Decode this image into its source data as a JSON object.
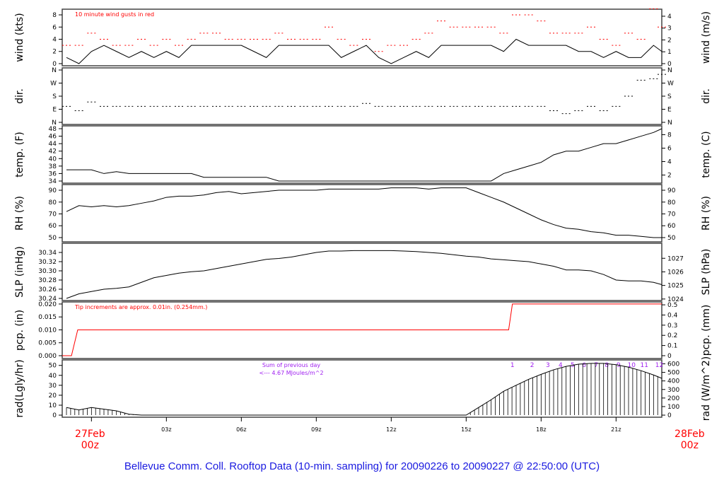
{
  "title": "Bellevue Comm. Coll. Rooftop Data (10-min. sampling) for 20090226  to  20090227 @ 22:50:00  (UTC)",
  "chart_data": {
    "type": "line",
    "title": "Bellevue Comm. Coll. Rooftop Data (10-min. sampling) for 20090226  to  20090227 @ 22:50:00  (UTC)",
    "x_range_hours": [
      -1.17,
      22.83
    ],
    "x_ticks": [
      {
        "t": 0,
        "label": "27Feb",
        "label2": "00z",
        "major": true
      },
      {
        "t": 3,
        "label": "03z"
      },
      {
        "t": 6,
        "label": "06z"
      },
      {
        "t": 9,
        "label": "09z"
      },
      {
        "t": 12,
        "label": "12z"
      },
      {
        "t": 15,
        "label": "15z"
      },
      {
        "t": 18,
        "label": "18z"
      },
      {
        "t": 21,
        "label": "21z"
      },
      {
        "t": 24,
        "label": "28Feb",
        "label2": "00z",
        "major": true
      }
    ],
    "colors": {
      "line": "#000000",
      "gust": "#ff0000",
      "pcp": "#ff0000",
      "annot": "#a020f0",
      "title": "#1a1ae0",
      "date": "#ff0000"
    },
    "t": [
      -1,
      -0.5,
      0,
      0.5,
      1,
      1.5,
      2,
      2.5,
      3,
      3.5,
      4,
      4.5,
      5,
      5.5,
      6,
      6.5,
      7,
      7.5,
      8,
      8.5,
      9,
      9.5,
      10,
      10.5,
      11,
      11.5,
      12,
      12.5,
      13,
      13.5,
      14,
      14.5,
      15,
      15.5,
      16,
      16.5,
      17,
      17.5,
      18,
      18.5,
      19,
      19.5,
      20,
      20.5,
      21,
      21.5,
      22,
      22.5,
      23
    ],
    "panels": [
      {
        "id": "wind",
        "ylabel": "wind (kts)",
        "ylabel_right": "wind (m/s)",
        "ylim": [
          -0.35,
          8.93
        ],
        "ticks": [
          {
            "v": 0,
            "l": "0"
          },
          {
            "v": 2,
            "l": "2"
          },
          {
            "v": 4,
            "l": "4"
          },
          {
            "v": 6,
            "l": "6"
          },
          {
            "v": 8,
            "l": "8"
          }
        ],
        "right_scale": 1.944,
        "right_offset": 0,
        "right_ticks": [
          {
            "v": 0,
            "l": "0"
          },
          {
            "v": 1,
            "l": "1"
          },
          {
            "v": 2,
            "l": "2"
          },
          {
            "v": 3,
            "l": "3"
          },
          {
            "v": 4,
            "l": "4"
          }
        ],
        "annotation": "10  minute wind gusts in red",
        "series": [
          {
            "name": "wind speed",
            "style": "line",
            "values": [
              1,
              0,
              2,
              3,
              2,
              1,
              2,
              1,
              2,
              1,
              3,
              3,
              3,
              3,
              3,
              2,
              1,
              3,
              3,
              3,
              3,
              3,
              1,
              2,
              3,
              1,
              0,
              1,
              2,
              1,
              3,
              3,
              3,
              3,
              3,
              2,
              4,
              3,
              3,
              3,
              3,
              2,
              2,
              1,
              2,
              1,
              1,
              3,
              2
            ]
          },
          {
            "name": "gust",
            "style": "dash-red",
            "values": [
              3,
              3,
              5,
              4,
              3,
              3,
              4,
              3,
              4,
              3,
              4,
              5,
              5,
              4,
              4,
              4,
              4,
              5,
              4,
              4,
              4,
              6,
              4,
              3,
              4,
              2,
              3,
              3,
              4,
              5,
              7,
              6,
              6,
              6,
              6,
              5,
              8,
              8,
              7,
              5,
              5,
              5,
              6,
              4,
              3,
              5,
              4,
              9,
              6
            ]
          }
        ]
      },
      {
        "id": "dir",
        "ylabel": "dir.",
        "ylabel_right": "dir.",
        "ylim": [
          -14.6,
          374.6
        ],
        "ticks": [
          {
            "v": 0,
            "l": "N"
          },
          {
            "v": 90,
            "l": "E"
          },
          {
            "v": 180,
            "l": "S"
          },
          {
            "v": 270,
            "l": "W"
          },
          {
            "v": 360,
            "l": "N"
          }
        ],
        "right_scale": 1,
        "right_offset": 0,
        "right_ticks": [
          {
            "v": 0,
            "l": "N"
          },
          {
            "v": 90,
            "l": "E"
          },
          {
            "v": 180,
            "l": "S"
          },
          {
            "v": 270,
            "l": "W"
          },
          {
            "v": 360,
            "l": "N"
          }
        ],
        "series": [
          {
            "name": "direction",
            "style": "dash",
            "values": [
              110,
              80,
              140,
              110,
              110,
              110,
              110,
              110,
              110,
              110,
              110,
              110,
              110,
              110,
              110,
              110,
              110,
              110,
              110,
              110,
              110,
              110,
              110,
              110,
              130,
              110,
              110,
              110,
              110,
              110,
              110,
              110,
              110,
              110,
              110,
              110,
              110,
              110,
              110,
              80,
              60,
              80,
              110,
              80,
              110,
              180,
              290,
              300,
              330
            ]
          }
        ]
      },
      {
        "id": "temp",
        "ylabel": "temp. (F)",
        "ylabel_right": "temp. (C)",
        "ylim": [
          33.43,
          48.76
        ],
        "ticks": [
          {
            "v": 34,
            "l": "34"
          },
          {
            "v": 36,
            "l": "36"
          },
          {
            "v": 38,
            "l": "38"
          },
          {
            "v": 40,
            "l": "40"
          },
          {
            "v": 42,
            "l": "42"
          },
          {
            "v": 44,
            "l": "44"
          },
          {
            "v": 46,
            "l": "46"
          },
          {
            "v": 48,
            "l": "48"
          }
        ],
        "right_scale": 1.8,
        "right_offset": 32,
        "right_ticks": [
          {
            "v": 2,
            "l": "2"
          },
          {
            "v": 4,
            "l": "4"
          },
          {
            "v": 6,
            "l": "6"
          },
          {
            "v": 8,
            "l": "8"
          }
        ],
        "series": [
          {
            "name": "temperature",
            "style": "step",
            "values": [
              37,
              37,
              37,
              36,
              36.5,
              36,
              36,
              36,
              36,
              36,
              36,
              35,
              35,
              35,
              35,
              35,
              35,
              34,
              34,
              34,
              34,
              34,
              34,
              34,
              34,
              34,
              34,
              34,
              34,
              34,
              34,
              34,
              34,
              34,
              34,
              36,
              37,
              38,
              39,
              41,
              42,
              42,
              43,
              44,
              44,
              45,
              46,
              47,
              48
            ]
          }
        ]
      },
      {
        "id": "rh",
        "ylabel": "RH (%)",
        "ylabel_right": "RH (%)",
        "ylim": [
          46.4,
          94.8
        ],
        "ticks": [
          {
            "v": 50,
            "l": "50"
          },
          {
            "v": 60,
            "l": "60"
          },
          {
            "v": 70,
            "l": "70"
          },
          {
            "v": 80,
            "l": "80"
          },
          {
            "v": 90,
            "l": "90"
          }
        ],
        "right_scale": 1,
        "right_offset": 0,
        "right_ticks": [
          {
            "v": 50,
            "l": "50"
          },
          {
            "v": 60,
            "l": "60"
          },
          {
            "v": 70,
            "l": "70"
          },
          {
            "v": 80,
            "l": "80"
          },
          {
            "v": 90,
            "l": "90"
          }
        ],
        "series": [
          {
            "name": "relative humidity",
            "style": "line",
            "values": [
              72,
              77,
              76,
              77,
              76,
              77,
              79,
              81,
              84,
              85,
              85,
              86,
              88,
              89,
              87,
              88,
              89,
              90,
              90,
              90,
              90,
              91,
              91,
              91,
              91,
              91,
              92,
              92,
              92,
              91,
              92,
              92,
              92,
              88,
              84,
              80,
              75,
              70,
              65,
              61,
              58,
              57,
              55,
              54,
              52,
              52,
              51,
              50,
              50
            ]
          }
        ]
      },
      {
        "id": "slp",
        "ylabel": "SLP (inHg)",
        "ylabel_right": "SLP (hPa)",
        "ylim": [
          30.2354,
          30.36
        ],
        "ticks": [
          {
            "v": 30.24,
            "l": "30.24"
          },
          {
            "v": 30.26,
            "l": "30.26"
          },
          {
            "v": 30.28,
            "l": "30.28"
          },
          {
            "v": 30.3,
            "l": "30.30"
          },
          {
            "v": 30.32,
            "l": "30.32"
          },
          {
            "v": 30.34,
            "l": "30.34"
          }
        ],
        "right_scale": 0.02953,
        "right_offset": 0,
        "right_ticks": [
          {
            "v": 1024,
            "l": "1024"
          },
          {
            "v": 1025,
            "l": "1025"
          },
          {
            "v": 1026,
            "l": "1026"
          },
          {
            "v": 1027,
            "l": "1027"
          }
        ],
        "series": [
          {
            "name": "sea level pressure",
            "style": "step",
            "values": [
              30.24,
              30.25,
              30.255,
              30.26,
              30.262,
              30.265,
              30.275,
              30.285,
              30.29,
              30.295,
              30.298,
              30.3,
              30.305,
              30.31,
              30.315,
              30.32,
              30.325,
              30.327,
              30.33,
              30.335,
              30.34,
              30.343,
              30.343,
              30.344,
              30.344,
              30.344,
              30.344,
              30.343,
              30.342,
              30.34,
              30.338,
              30.335,
              30.332,
              30.33,
              30.326,
              30.324,
              30.322,
              30.32,
              30.315,
              30.31,
              30.302,
              30.302,
              30.3,
              30.292,
              30.28,
              30.278,
              30.278,
              30.275,
              30.27
            ]
          }
        ]
      },
      {
        "id": "pcp",
        "ylabel": "pcp. (in)",
        "ylabel_right": "pcp. (mm)",
        "ylim": [
          -0.0011,
          0.0208
        ],
        "ticks": [
          {
            "v": 0,
            "l": "0.000"
          },
          {
            "v": 0.005,
            "l": "0.005"
          },
          {
            "v": 0.01,
            "l": "0.010"
          },
          {
            "v": 0.015,
            "l": "0.015"
          },
          {
            "v": 0.02,
            "l": "0.020"
          }
        ],
        "right_scale": 0.03937,
        "right_offset": 0,
        "right_ticks": [
          {
            "v": 0,
            "l": "0"
          },
          {
            "v": 0.1,
            "l": "0.1"
          },
          {
            "v": 0.2,
            "l": "0.2"
          },
          {
            "v": 0.3,
            "l": "0.3"
          },
          {
            "v": 0.4,
            "l": "0.4"
          },
          {
            "v": 0.5,
            "l": "0.5"
          }
        ],
        "annotation": "Tip increments are approx. 0.01in. (0.254mm.)",
        "points": [
          [
            -1.17,
            0
          ],
          [
            -0.8,
            0
          ],
          [
            -0.55,
            0.01
          ],
          [
            16.7,
            0.01
          ],
          [
            16.85,
            0.02
          ],
          [
            22.83,
            0.02
          ]
        ]
      },
      {
        "id": "rad",
        "ylabel": "rad(Lgly/hr)",
        "ylabel_right": "rad (W/m^2)",
        "ylim": [
          -2.1,
          55.5
        ],
        "ticks": [
          {
            "v": 0,
            "l": "0"
          },
          {
            "v": 10,
            "l": "10"
          },
          {
            "v": 20,
            "l": "20"
          },
          {
            "v": 30,
            "l": "30"
          },
          {
            "v": 40,
            "l": "40"
          },
          {
            "v": 50,
            "l": "50"
          }
        ],
        "right_scale": 0.086,
        "right_offset": 0,
        "right_ticks": [
          {
            "v": 0,
            "l": "0"
          },
          {
            "v": 100,
            "l": "100"
          },
          {
            "v": 200,
            "l": "200"
          },
          {
            "v": 300,
            "l": "300"
          },
          {
            "v": 400,
            "l": "400"
          },
          {
            "v": 500,
            "l": "500"
          },
          {
            "v": 600,
            "l": "600"
          }
        ],
        "annotation": "Sum of previous day",
        "annotation2": "<--- 4.67 MJoules/m^2",
        "hour_marks": [
          {
            "t": 16.85,
            "l": "1"
          },
          {
            "t": 17.64,
            "l": "2"
          },
          {
            "t": 18.27,
            "l": "3"
          },
          {
            "t": 18.78,
            "l": "4"
          },
          {
            "t": 19.26,
            "l": "5"
          },
          {
            "t": 19.72,
            "l": "6"
          },
          {
            "t": 20.2,
            "l": "7"
          },
          {
            "t": 20.63,
            "l": "8"
          },
          {
            "t": 21.1,
            "l": "9"
          },
          {
            "t": 21.62,
            "l": "10"
          },
          {
            "t": 22.13,
            "l": "11"
          },
          {
            "t": 22.73,
            "l": "12"
          }
        ],
        "series": [
          {
            "name": "solar radiation",
            "style": "bars",
            "values": [
              7.7,
              5.2,
              7.7,
              6,
              4.3,
              0.9,
              0,
              0,
              0,
              0,
              0,
              0,
              0,
              0,
              0,
              0,
              0,
              0,
              0,
              0,
              0,
              0,
              0,
              0,
              0,
              0,
              0,
              0,
              0,
              0,
              0,
              0,
              0,
              7.7,
              15.5,
              24,
              30,
              36,
              41,
              45.6,
              49,
              51.2,
              52,
              52,
              50.7,
              48.2,
              44.7,
              40.4,
              37
            ]
          }
        ]
      }
    ]
  }
}
